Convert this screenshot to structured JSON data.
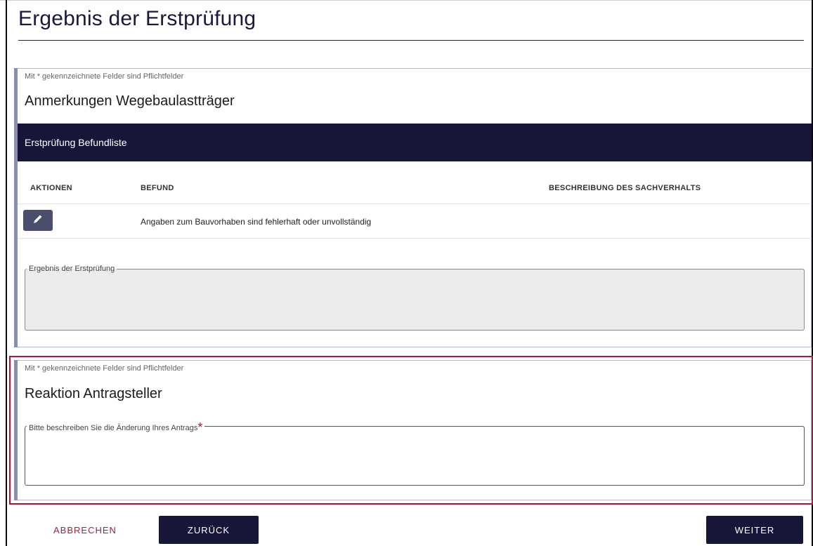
{
  "page": {
    "title": "Ergebnis der Erstprüfung"
  },
  "colors": {
    "primary_dark": "#161638",
    "accent_red": "#a3213d",
    "highlight_border": "#b0143b"
  },
  "section_review": {
    "required_note": "Mit * gekennzeichnete Felder sind Pflichtfelder",
    "title": "Anmerkungen Wegebaulastträger",
    "findings_banner": "Erstprüfung Befundliste",
    "table": {
      "headers": [
        "AKTIONEN",
        "BEFUND",
        "BESCHREIBUNG DES SACHVERHALTS"
      ],
      "rows": [
        {
          "action_icon": "pencil-icon",
          "befund": "Angaben zum Bauvorhaben sind fehlerhaft oder unvollständig",
          "beschreibung": ""
        }
      ]
    },
    "result_field": {
      "label": "Ergebnis der Erstprüfung",
      "value": ""
    }
  },
  "section_reaction": {
    "required_note": "Mit * gekennzeichnete Felder sind Pflichtfelder",
    "title": "Reaktion Antragsteller",
    "change_field": {
      "label": "Bitte beschreiben Sie die Änderung Ihres Antrags",
      "required_marker": "*",
      "value": ""
    }
  },
  "footer": {
    "cancel_label": "ABBRECHEN",
    "back_label": "ZURÜCK",
    "next_label": "WEITER"
  }
}
